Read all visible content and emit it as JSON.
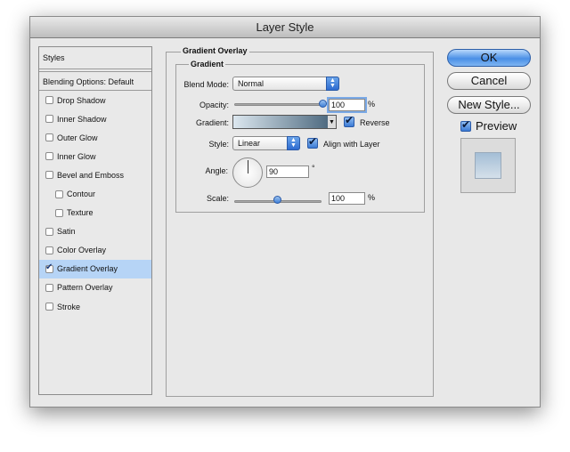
{
  "window": {
    "title": "Layer Style"
  },
  "styles": {
    "header": "Styles",
    "blending_options": "Blending Options: Default",
    "items": [
      {
        "label": "Drop Shadow",
        "checked": false,
        "sub": false
      },
      {
        "label": "Inner Shadow",
        "checked": false,
        "sub": false
      },
      {
        "label": "Outer Glow",
        "checked": false,
        "sub": false
      },
      {
        "label": "Inner Glow",
        "checked": false,
        "sub": false
      },
      {
        "label": "Bevel and Emboss",
        "checked": false,
        "sub": false
      },
      {
        "label": "Contour",
        "checked": false,
        "sub": true
      },
      {
        "label": "Texture",
        "checked": false,
        "sub": true
      },
      {
        "label": "Satin",
        "checked": false,
        "sub": false
      },
      {
        "label": "Color Overlay",
        "checked": false,
        "sub": false
      },
      {
        "label": "Gradient Overlay",
        "checked": true,
        "sub": false,
        "selected": true
      },
      {
        "label": "Pattern Overlay",
        "checked": false,
        "sub": false
      },
      {
        "label": "Stroke",
        "checked": false,
        "sub": false
      }
    ]
  },
  "panel": {
    "title": "Gradient Overlay",
    "group_title": "Gradient",
    "blend_mode": {
      "label": "Blend Mode:",
      "value": "Normal"
    },
    "opacity": {
      "label": "Opacity:",
      "value": "100",
      "unit": "%",
      "level": 1.0
    },
    "gradient": {
      "label": "Gradient:",
      "reverse_label": "Reverse",
      "reverse_checked": true,
      "from_color": "#dce7ef",
      "to_color": "#4e6a80"
    },
    "style": {
      "label": "Style:",
      "value": "Linear",
      "align_label": "Align with Layer",
      "align_checked": true
    },
    "angle": {
      "label": "Angle:",
      "value": "90",
      "unit": "°"
    },
    "scale": {
      "label": "Scale:",
      "value": "100",
      "unit": "%",
      "level": 0.5
    }
  },
  "buttons": {
    "ok": "OK",
    "cancel": "Cancel",
    "new_style": "New Style..."
  },
  "preview": {
    "label": "Preview",
    "checked": true
  },
  "colors": {
    "accent": "#4a8fe6",
    "selection": "#b6d4f6"
  }
}
